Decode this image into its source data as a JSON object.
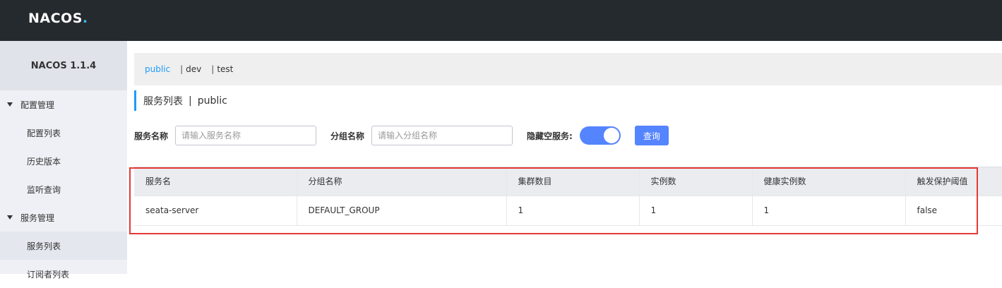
{
  "logo": {
    "text": "NACOS",
    "dot": "."
  },
  "sidebar": {
    "title": "NACOS 1.1.4",
    "groups": [
      {
        "label": "配置管理",
        "items": [
          "配置列表",
          "历史版本",
          "监听查询"
        ]
      },
      {
        "label": "服务管理",
        "items": [
          "服务列表",
          "订阅者列表"
        ]
      }
    ]
  },
  "namespaces": [
    "public",
    "dev",
    "test"
  ],
  "ns_separator": "|",
  "page": {
    "title": "服务列表",
    "separator": "|",
    "namespace": "public"
  },
  "filters": {
    "service_name_label": "服务名称",
    "service_name_placeholder": "请输入服务名称",
    "group_name_label": "分组名称",
    "group_name_placeholder": "请输入分组名称",
    "hide_empty_label": "隐藏空服务:",
    "hide_empty_on": true,
    "query_button": "查询"
  },
  "table": {
    "columns": [
      "服务名",
      "分组名称",
      "集群数目",
      "实例数",
      "健康实例数",
      "触发保护阈值"
    ],
    "rows": [
      [
        "seata-server",
        "DEFAULT_GROUP",
        "1",
        "1",
        "1",
        "false"
      ]
    ]
  },
  "colors": {
    "accent": "#209bfa",
    "primary": "#5584ff",
    "highlight": "#e53935",
    "topbar": "#252a2f"
  }
}
